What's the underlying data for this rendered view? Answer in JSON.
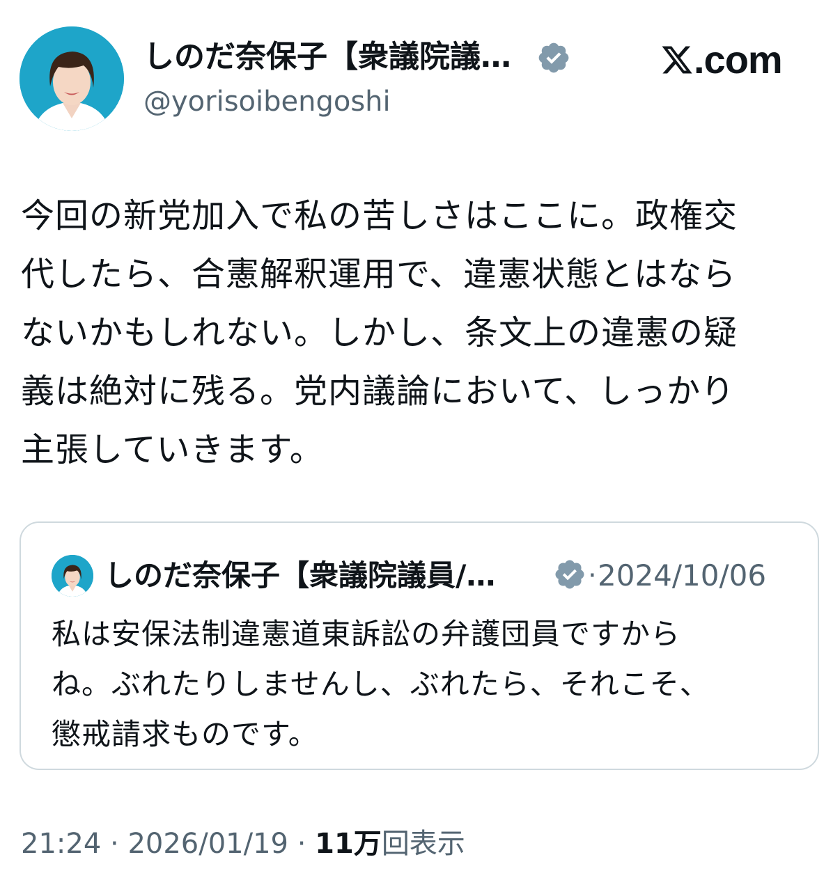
{
  "author": {
    "display_name": "しのだ奈保子【衆議院議…",
    "handle": "@yorisoibengoshi",
    "avatar_icon": "profile-photo",
    "verified_icon": "verified-badge-icon"
  },
  "site": {
    "label": ".com",
    "logo_icon": "x-logo-icon"
  },
  "tweet": {
    "text": "今回の新党加入で私の苦しさはここに。政権交\n代したら、合憲解釈運用で、違憲状態とはなら\nないかもしれない。しかし、条文上の違憲の疑\n義は絶対に残る。党内議論において、しっかり\n主張していきます。"
  },
  "quoted_tweet": {
    "display_name": "しのだ奈保子【衆議院議員/…",
    "separator": "·",
    "date": "2024/10/06",
    "text": "私は安保法制違憲道東訴訟の弁護団員ですから\nね。ぶれたりしませんし、ぶれたら、それこそ、\n懲戒請求ものです。"
  },
  "meta": {
    "time": "21:24",
    "sep1": " · ",
    "date": "2026/01/19",
    "sep2": " · ",
    "views_count": "11万",
    "views_label": "回表示"
  },
  "colors": {
    "text": "#0f1419",
    "secondary": "#536471",
    "border": "#cfd9de",
    "verified_badge": "#829aab",
    "avatar_bg": "#1ea5c9"
  }
}
